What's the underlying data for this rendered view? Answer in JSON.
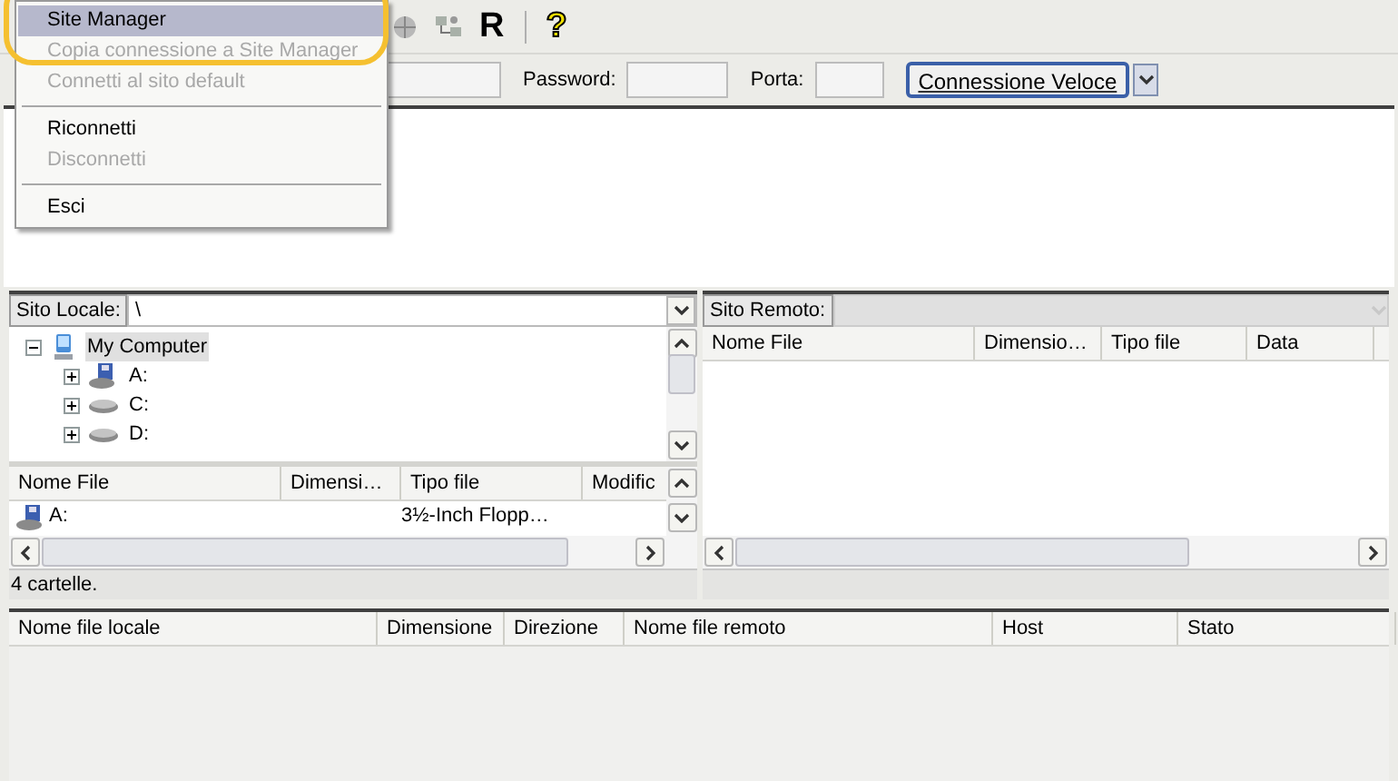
{
  "file_menu": {
    "items": [
      {
        "kind": "item",
        "label": "Site Manager",
        "selected": true,
        "disabled": false
      },
      {
        "kind": "item",
        "label": "Copia connessione a Site Manager",
        "selected": false,
        "disabled": true
      },
      {
        "kind": "item",
        "label": "Connetti al sito default",
        "selected": false,
        "disabled": true
      },
      {
        "kind": "separator"
      },
      {
        "kind": "item",
        "label": "Riconnetti",
        "selected": false,
        "disabled": false
      },
      {
        "kind": "item",
        "label": "Disconnetti",
        "selected": false,
        "disabled": true
      },
      {
        "kind": "separator"
      },
      {
        "kind": "item",
        "label": "Esci",
        "selected": false,
        "disabled": false
      }
    ]
  },
  "toolbar": {
    "items": [
      {
        "kind": "globe"
      },
      {
        "kind": "network"
      },
      {
        "kind": "text",
        "label": "R"
      },
      {
        "kind": "separator"
      },
      {
        "kind": "help",
        "label": "?"
      }
    ]
  },
  "quickconnect": {
    "fields": [
      {
        "kind": "host"
      },
      {
        "label": "Password:",
        "kind": "password"
      },
      {
        "label": "Porta:",
        "kind": "port"
      }
    ],
    "button": "Connessione Veloce"
  },
  "local": {
    "label": "Sito Locale:",
    "path": "\\",
    "tree": [
      {
        "label": "My Computer",
        "kind": "computer",
        "expanded": true,
        "selected": true,
        "children": [
          {
            "label": "A:",
            "kind": "floppy",
            "expanded": false,
            "selected": false
          },
          {
            "label": "C:",
            "kind": "drive",
            "expanded": false,
            "selected": false
          },
          {
            "label": "D:",
            "kind": "drive",
            "expanded": false,
            "selected": false
          }
        ]
      }
    ],
    "columns": [
      "Nome File",
      "Dimensi…",
      "Tipo file",
      "Modific"
    ],
    "rows": [
      {
        "name": "A:",
        "type": "3½-Inch Flopp…"
      }
    ],
    "status": "4 cartelle."
  },
  "remote": {
    "label": "Sito Remoto:",
    "columns": [
      "Nome File",
      "Dimensio…",
      "Tipo file",
      "Data"
    ]
  },
  "queue": {
    "columns": [
      "Nome file locale",
      "Dimensione",
      "Direzione",
      "Nome file remoto",
      "Host",
      "Stato"
    ]
  }
}
